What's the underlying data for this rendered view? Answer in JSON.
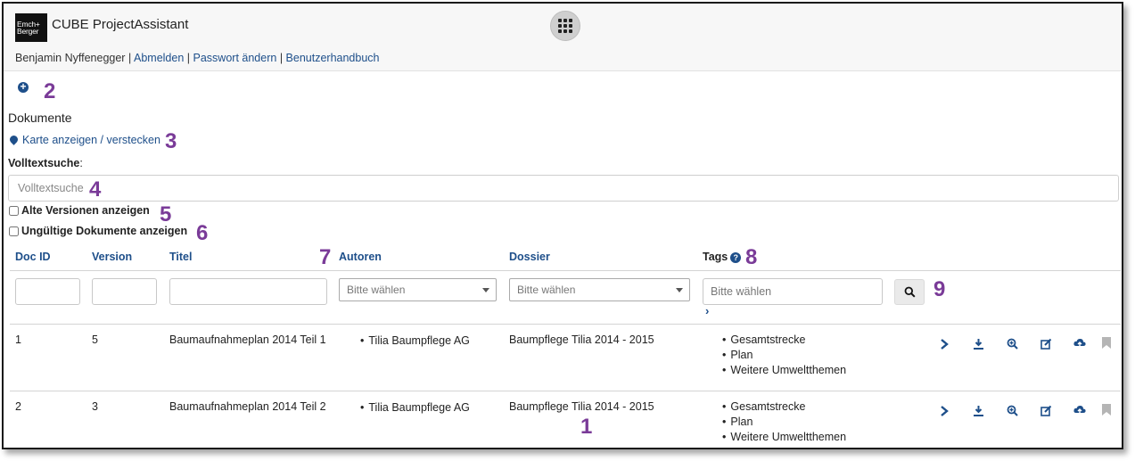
{
  "app": {
    "logo_text": "Emch+\nBerger",
    "title": "CUBE ProjectAssistant"
  },
  "userbar": {
    "user": "Benjamin Nyffenegger",
    "sep": "|",
    "logout": "Abmelden",
    "change_password": "Passwort ändern",
    "manual": "Benutzerhandbuch"
  },
  "page": {
    "heading": "Dokumente",
    "map_toggle": "Karte anzeigen / verstecken"
  },
  "search": {
    "label": "Volltextsuche",
    "label_suffix": ":",
    "placeholder": "Volltextsuche"
  },
  "options": {
    "old_versions": "Alte Versionen anzeigen",
    "invalid_docs": "Ungültige Dokumente anzeigen"
  },
  "columns": {
    "doc_id": "Doc ID",
    "version": "Version",
    "title": "Titel",
    "authors": "Autoren",
    "dossier": "Dossier",
    "tags": "Tags"
  },
  "filters": {
    "authors_placeholder": "Bitte wählen",
    "dossier_placeholder": "Bitte wählen",
    "tags_placeholder": "Bitte wählen"
  },
  "rows": [
    {
      "doc_id": "1",
      "version": "5",
      "title": "Baumaufnahmeplan 2014 Teil 1",
      "author": "Tilia Baumpflege AG",
      "dossier": "Baumpflege Tilia 2014 - 2015",
      "tags": [
        "Gesamtstrecke",
        "Plan",
        "Weitere Umweltthemen"
      ]
    },
    {
      "doc_id": "2",
      "version": "3",
      "title": "Baumaufnahmeplan 2014 Teil 2",
      "author": "Tilia Baumpflege AG",
      "dossier": "Baumpflege Tilia 2014 - 2015",
      "tags": [
        "Gesamtstrecke",
        "Plan",
        "Weitere Umweltthemen"
      ]
    }
  ],
  "callouts": {
    "c1": "1",
    "c2": "2",
    "c3": "3",
    "c4": "4",
    "c5": "5",
    "c6": "6",
    "c7": "7",
    "c8": "8",
    "c9": "9"
  },
  "colors": {
    "link": "#1e4f8a",
    "callout": "#7a3b98",
    "header_bg": "#f7f7f7"
  }
}
